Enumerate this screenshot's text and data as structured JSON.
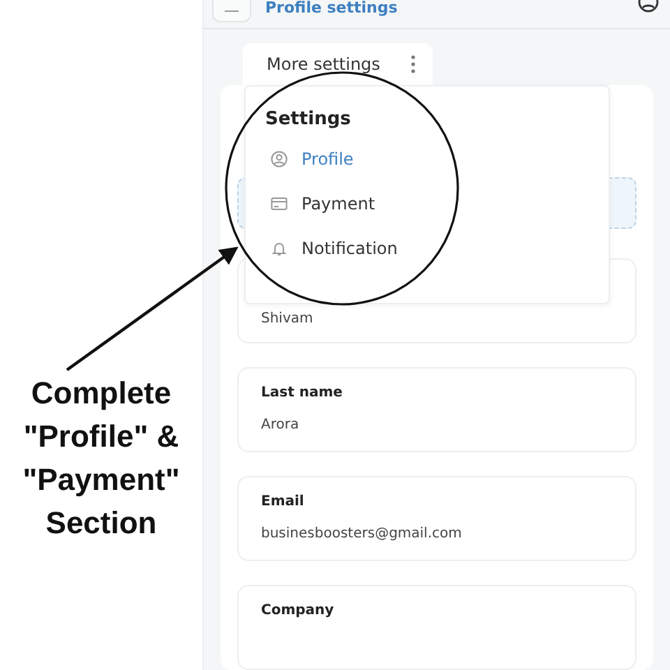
{
  "header": {
    "title": "Profile settings"
  },
  "more_settings": {
    "label": "More settings"
  },
  "menu": {
    "title": "Settings",
    "items": [
      {
        "label": "Profile",
        "selected": true
      },
      {
        "label": "Payment",
        "selected": false
      },
      {
        "label": "Notification",
        "selected": false
      }
    ]
  },
  "fields": [
    {
      "value": "Shivam"
    },
    {
      "label": "Last name",
      "value": "Arora"
    },
    {
      "label": "Email",
      "value": "businesboosters@gmail.com"
    },
    {
      "label": "Company"
    }
  ],
  "annotation": {
    "lines": [
      "Complete",
      "\"Profile\" &",
      "\"Payment\"",
      "Section"
    ]
  }
}
